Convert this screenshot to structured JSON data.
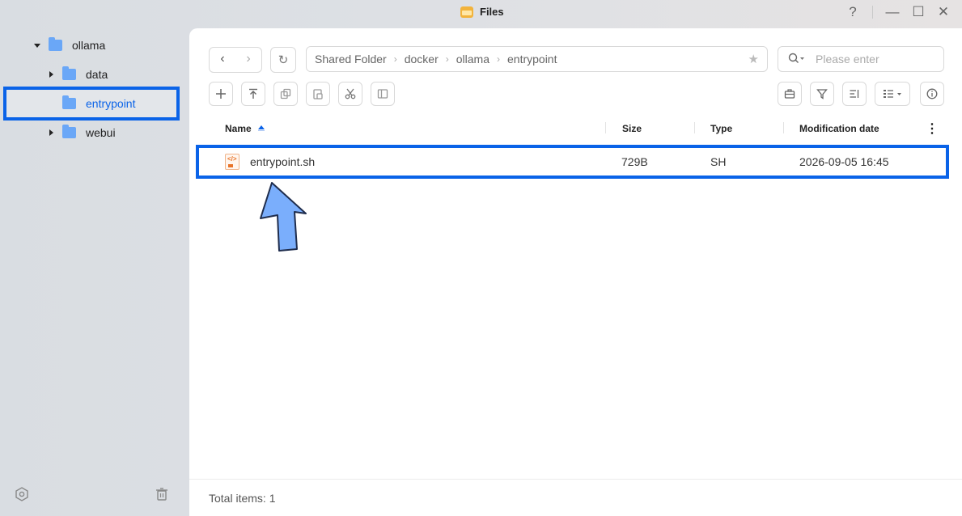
{
  "window": {
    "title": "Files",
    "help": "?",
    "minimize": "—",
    "maximize": "☐",
    "close": "✕"
  },
  "sidebar": {
    "items": [
      {
        "label": "ollama"
      },
      {
        "label": "data"
      },
      {
        "label": "entrypoint"
      },
      {
        "label": "webui"
      }
    ]
  },
  "toolbar": {
    "back": "‹",
    "forward": "›",
    "refresh": "↻",
    "breadcrumb": [
      "Shared Folder",
      "docker",
      "ollama",
      "entrypoint"
    ],
    "crumb_separator": "›",
    "favorite": "★",
    "search": {
      "placeholder": "Please enter",
      "value": ""
    }
  },
  "table": {
    "columns": {
      "name": "Name",
      "size": "Size",
      "type": "Type",
      "modified": "Modification date"
    },
    "more": "⋮",
    "rows": [
      {
        "name": "entrypoint.sh",
        "size": "729B",
        "type": "SH",
        "modified": "2026-09-05 16:45",
        "icon_text": "</>"
      }
    ]
  },
  "footer": {
    "total": "Total items: 1"
  },
  "colors": {
    "accent": "#0a63e8",
    "folder": "#6aa7f7",
    "arrow_fill": "#7aaefc"
  }
}
